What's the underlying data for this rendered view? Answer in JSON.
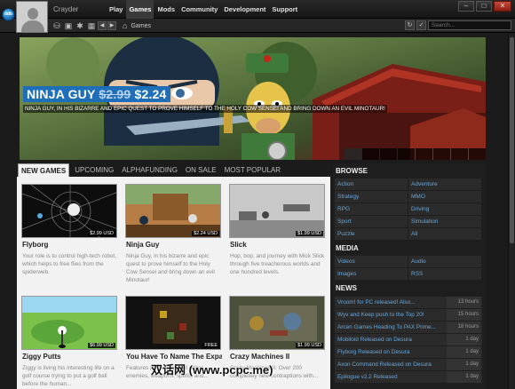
{
  "app": {
    "username": "Crayder",
    "logo_text": "ddb"
  },
  "nav": {
    "items": [
      {
        "label": "Play"
      },
      {
        "label": "Games",
        "active": true
      },
      {
        "label": "Mods"
      },
      {
        "label": "Community"
      },
      {
        "label": "Development"
      },
      {
        "label": "Support"
      }
    ]
  },
  "toolbar": {
    "location": "Games",
    "search_placeholder": "Search..."
  },
  "banner": {
    "title": "NINJA GUY",
    "old_price": "$2.99",
    "new_price": "$2.24",
    "description": "NINJA GUY, IN HIS BIZARRE AND EPIC QUEST TO PROVE HIMSELF TO THE HOLY COW SENSEI AND BRING DOWN AN EVIL MINOTAUR!",
    "page_count": 8
  },
  "tabs": [
    {
      "label": "NEW GAMES",
      "active": true
    },
    {
      "label": "UPCOMING"
    },
    {
      "label": "ALPHAFUNDING"
    },
    {
      "label": "ON SALE"
    },
    {
      "label": "MOST POPULAR"
    }
  ],
  "games": [
    {
      "title": "Flyborg",
      "price": "$2.99 USD",
      "description": "Your role is to control high-tech robot, which helps to free flies from the spiderweb."
    },
    {
      "title": "Ninja Guy",
      "price": "$2.24 USD",
      "description": "Ninja Guy, in his bizarre and epic quest to prove himself to the Holy Cow Sensei and bring down an evil Minotaur!"
    },
    {
      "title": "Slick",
      "price": "$1.99 USD",
      "description": "Hop, bop, and journey with Mick Slick through five treacherous worlds and one hundred levels."
    },
    {
      "title": "Ziggy Putts",
      "price": "$6.99 USD",
      "description": "Ziggy is living his interesting life on a golf course trying to put a golf ball before the human..."
    },
    {
      "title": "You Have To Name The Expansion",
      "price": "FREE",
      "description": "Features a random level editor, enemies, weapons, spells, and..."
    },
    {
      "title": "Crazy Machines II",
      "price": "$1.99 USD",
      "description": "Crazy Machines II: Over 200 completely new contraptions with..."
    }
  ],
  "sidebar": {
    "browse_title": "BROWSE",
    "browse": [
      "Action",
      "Adventure",
      "Strategy",
      "MMO",
      "RPG",
      "Driving",
      "Sport",
      "Simulation",
      "Puzzle",
      "All"
    ],
    "media_title": "MEDIA",
    "media": [
      "Videos",
      "Audio",
      "Images",
      "RSS"
    ],
    "news_title": "NEWS",
    "news": [
      {
        "title": "Vroom! for PC released! Also...",
        "time": "13 hours"
      },
      {
        "title": "Wyv and Keep push to the Top 20!",
        "time": "15 hours"
      },
      {
        "title": "Arcen Games Heading To PAX Prime...",
        "time": "18 hours"
      },
      {
        "title": "Mobiloid Released on Desura",
        "time": "1 day"
      },
      {
        "title": "Flyborg Released on Desura",
        "time": "1 day"
      },
      {
        "title": "Axon Command Released on Desura",
        "time": "1 day"
      },
      {
        "title": "Epilogue v2.2 Released",
        "time": "1 day"
      }
    ]
  },
  "watermark": "双话网 (www.pcpc.me)"
}
